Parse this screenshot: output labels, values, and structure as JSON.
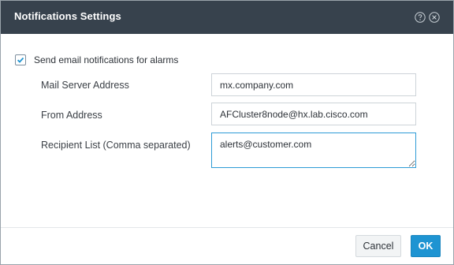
{
  "dialog": {
    "title": "Notifications Settings"
  },
  "icons": {
    "help": "help-circle-icon",
    "close": "close-circle-icon"
  },
  "notify": {
    "label": "Send email notifications for alarms",
    "checked": true
  },
  "fields": {
    "mail_server": {
      "label": "Mail Server Address",
      "value": "mx.company.com"
    },
    "from_address": {
      "label": "From Address",
      "value": "AFCluster8node@hx.lab.cisco.com"
    },
    "recipient_list": {
      "label": "Recipient List (Comma separated)",
      "value": "alerts@customer.com"
    }
  },
  "buttons": {
    "cancel": "Cancel",
    "ok": "OK"
  },
  "colors": {
    "titlebar": "#37424d",
    "accent": "#1e94d2",
    "focus_border": "#2d9bd6"
  }
}
